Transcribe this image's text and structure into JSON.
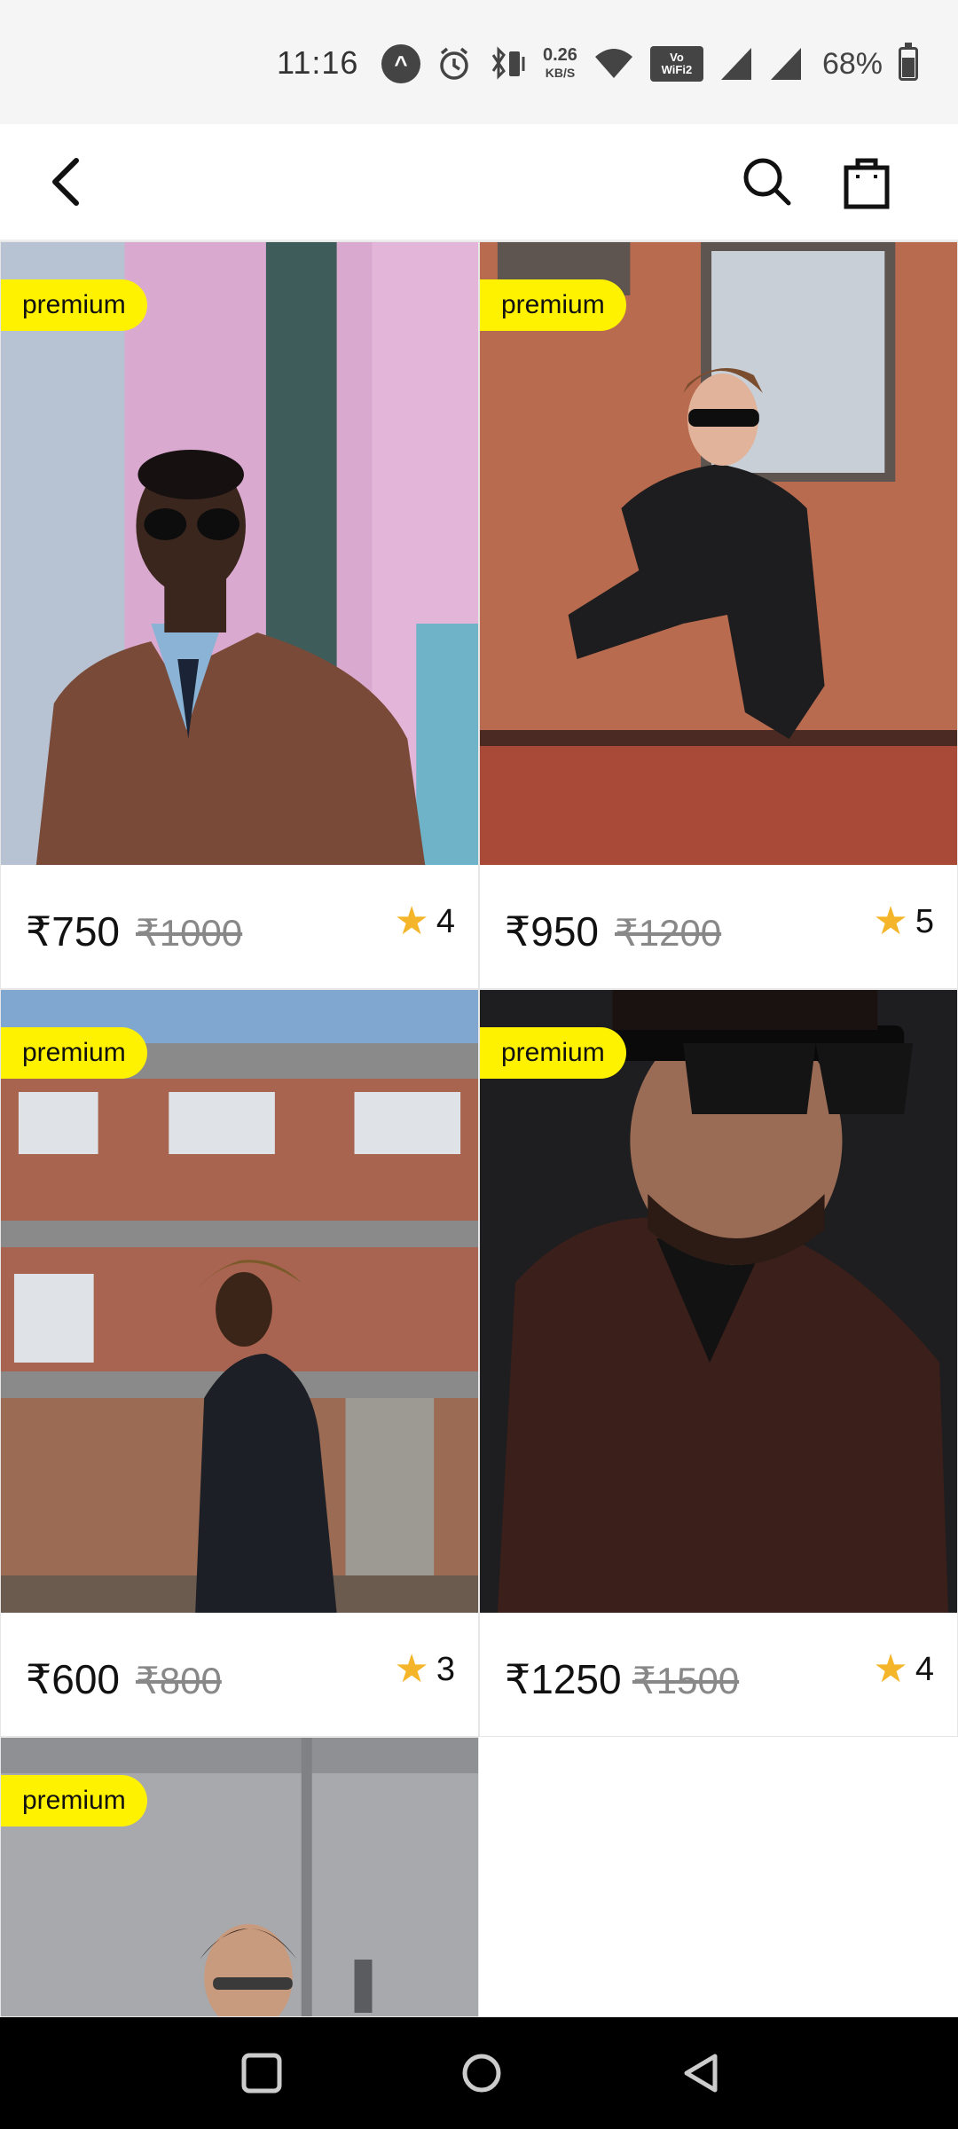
{
  "status_bar": {
    "time": "11:16",
    "net_speed_value": "0.26",
    "net_speed_unit": "KB/S",
    "vowifi_top": "Vo",
    "vowifi_bottom": "WiFi2",
    "battery_percent": "68%",
    "battery_level": 0.68,
    "icons": [
      "app-notification-icon",
      "alarm-icon",
      "bluetooth-vibrate-icon",
      "wifi-icon",
      "vowifi-icon",
      "signal-icon",
      "signal-icon",
      "battery-icon"
    ]
  },
  "app_bar": {
    "back_icon": "back-arrow-icon",
    "search_icon": "search-icon",
    "bag_icon": "shopping-bag-icon"
  },
  "products": [
    {
      "badge": "premium",
      "price": "₹750",
      "old_price": "₹1000",
      "rating": "4"
    },
    {
      "badge": "premium",
      "price": "₹950",
      "old_price": "₹1200",
      "rating": "5"
    },
    {
      "badge": "premium",
      "price": "₹600",
      "old_price": "₹800",
      "rating": "3"
    },
    {
      "badge": "premium",
      "price": "₹1250",
      "old_price": "₹1500",
      "rating": "4"
    },
    {
      "badge": "premium"
    }
  ],
  "colors": {
    "badge": "#fff200",
    "star": "#f5b52a",
    "old_price": "#888888",
    "nav_bar": "#000000"
  },
  "nav_bar": {
    "icons": [
      "recent-apps-icon",
      "home-icon",
      "back-icon"
    ]
  }
}
